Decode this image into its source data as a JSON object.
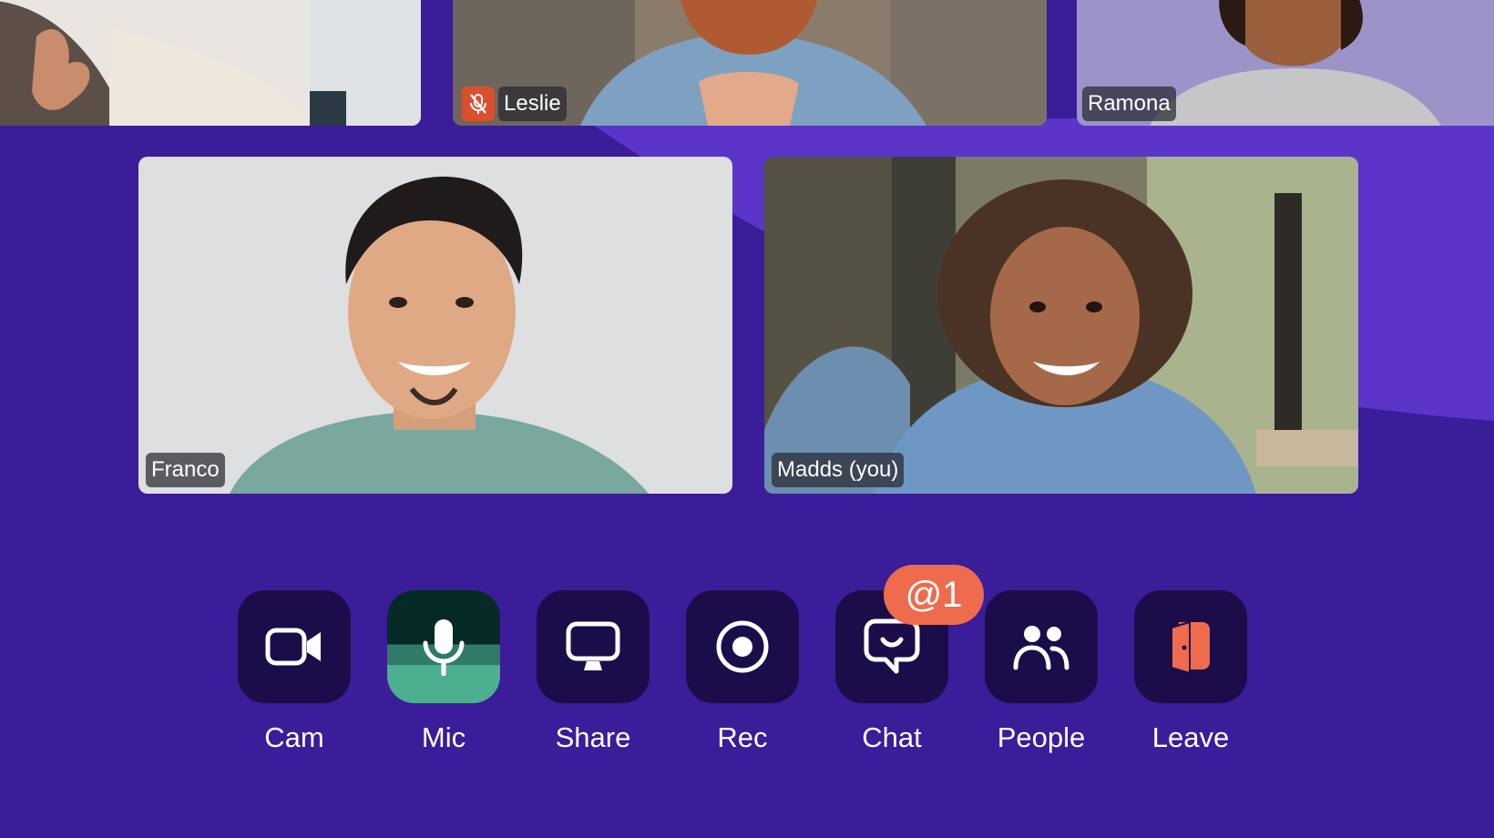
{
  "participants": [
    {
      "name": "",
      "muted": false
    },
    {
      "name": "Leslie",
      "muted": true
    },
    {
      "name": "Ramona",
      "muted": false
    },
    {
      "name": "Franco",
      "muted": false
    },
    {
      "name": "Madds (you)",
      "muted": false
    }
  ],
  "controls": [
    {
      "label": "Cam",
      "icon": "video-camera-icon"
    },
    {
      "label": "Mic",
      "icon": "microphone-icon",
      "active": true
    },
    {
      "label": "Share",
      "icon": "monitor-icon"
    },
    {
      "label": "Rec",
      "icon": "record-icon"
    },
    {
      "label": "Chat",
      "icon": "chat-bubble-icon"
    },
    {
      "label": "People",
      "icon": "people-icon"
    },
    {
      "label": "Leave",
      "icon": "door-exit-icon"
    }
  ],
  "chat_badge": "@1",
  "colors": {
    "background": "#3b1c99",
    "background_shape": "#5a35c8",
    "button": "#1b0d4a",
    "mic_active": "#4caf8f",
    "accent": "#ee6c4d"
  }
}
